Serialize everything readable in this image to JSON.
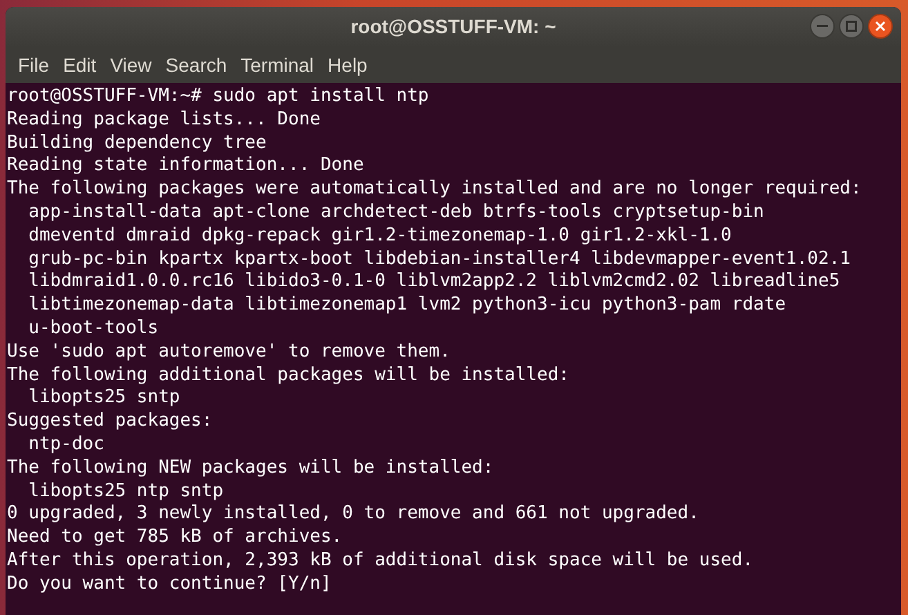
{
  "window": {
    "title": "root@OSSTUFF-VM: ~"
  },
  "menu": [
    "File",
    "Edit",
    "View",
    "Search",
    "Terminal",
    "Help"
  ],
  "terminal": {
    "lines": [
      "root@OSSTUFF-VM:~# sudo apt install ntp",
      "Reading package lists... Done",
      "Building dependency tree",
      "Reading state information... Done",
      "The following packages were automatically installed and are no longer required:",
      "  app-install-data apt-clone archdetect-deb btrfs-tools cryptsetup-bin",
      "  dmeventd dmraid dpkg-repack gir1.2-timezonemap-1.0 gir1.2-xkl-1.0",
      "  grub-pc-bin kpartx kpartx-boot libdebian-installer4 libdevmapper-event1.02.1",
      "  libdmraid1.0.0.rc16 libido3-0.1-0 liblvm2app2.2 liblvm2cmd2.02 libreadline5",
      "  libtimezonemap-data libtimezonemap1 lvm2 python3-icu python3-pam rdate",
      "  u-boot-tools",
      "Use 'sudo apt autoremove' to remove them.",
      "The following additional packages will be installed:",
      "  libopts25 sntp",
      "Suggested packages:",
      "  ntp-doc",
      "The following NEW packages will be installed:",
      "  libopts25 ntp sntp",
      "0 upgraded, 3 newly installed, 0 to remove and 661 not upgraded.",
      "Need to get 785 kB of archives.",
      "After this operation, 2,393 kB of additional disk space will be used.",
      "Do you want to continue? [Y/n]"
    ]
  }
}
